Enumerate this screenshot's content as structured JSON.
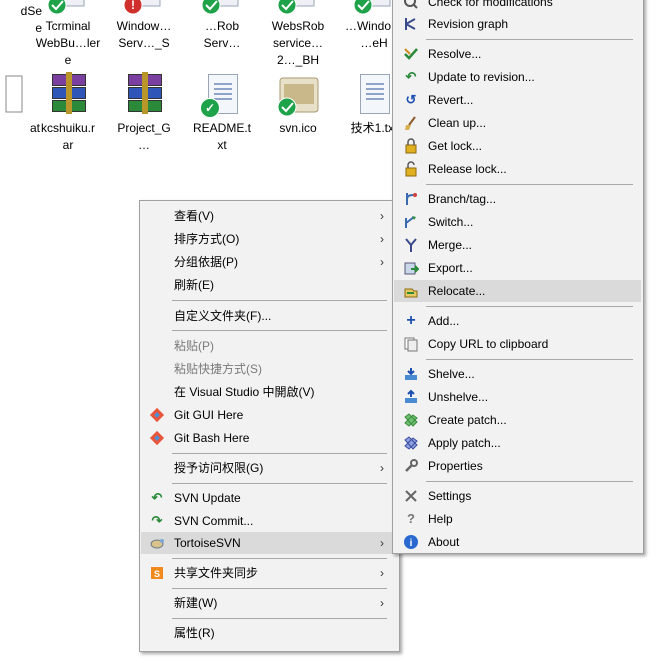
{
  "desktop": {
    "files": [
      {
        "label": "ata\ndSe\ne",
        "kind": "partial"
      },
      {
        "label": "Tcrminal\nWebBu…ler\ne",
        "kind": "vs"
      },
      {
        "label": "Window…\nServ…_S",
        "kind": "vs-error"
      },
      {
        "label": "…Rob\nServ…",
        "kind": "vs"
      },
      {
        "label": "WebsRob\nservice…\n2…_BH",
        "kind": "vs"
      },
      {
        "label": "…Windo…\n…eH",
        "kind": "vs"
      },
      {
        "label": "at",
        "kind": "partial"
      },
      {
        "label": "kcshuiku.r\nar",
        "kind": "rar"
      },
      {
        "label": "Project_G\n…",
        "kind": "rar"
      },
      {
        "label": "README.t\nxt",
        "kind": "doc-svn"
      },
      {
        "label": "svn.ico",
        "kind": "svn-ico"
      },
      {
        "label": "技术1.txt",
        "kind": "doc"
      }
    ]
  },
  "context_menu": {
    "items": [
      {
        "label": "查看(V)",
        "submenu": true,
        "icon": ""
      },
      {
        "label": "排序方式(O)",
        "submenu": true,
        "icon": ""
      },
      {
        "label": "分组依据(P)",
        "submenu": true,
        "icon": ""
      },
      {
        "label": "刷新(E)",
        "submenu": false,
        "icon": ""
      },
      {
        "label": "自定义文件夹(F)...",
        "submenu": false,
        "icon": ""
      },
      {
        "label": "粘贴(P)",
        "submenu": false,
        "icon": "",
        "disabled": true
      },
      {
        "label": "粘贴快捷方式(S)",
        "submenu": false,
        "icon": "",
        "disabled": true
      },
      {
        "label": "在 Visual Studio 中開啟(V)",
        "submenu": false,
        "icon": ""
      },
      {
        "label": "Git GUI Here",
        "submenu": false,
        "icon": "git-icon"
      },
      {
        "label": "Git Bash Here",
        "submenu": false,
        "icon": "git-icon"
      },
      {
        "label": "授予访问权限(G)",
        "submenu": true,
        "icon": ""
      },
      {
        "label": "SVN Update",
        "submenu": false,
        "icon": "svn-update-icon"
      },
      {
        "label": "SVN Commit...",
        "submenu": false,
        "icon": "svn-commit-icon"
      },
      {
        "label": "TortoiseSVN",
        "submenu": true,
        "icon": "tortoise-icon",
        "highlighted": true
      },
      {
        "label": "共享文件夹同步",
        "submenu": true,
        "icon": "sync-icon"
      },
      {
        "label": "新建(W)",
        "submenu": true,
        "icon": ""
      },
      {
        "label": "属性(R)",
        "submenu": false,
        "icon": ""
      }
    ]
  },
  "tortoise_submenu": {
    "items": [
      {
        "label": "Check for modifications",
        "icon": "check-mod-icon"
      },
      {
        "label": "Revision graph",
        "icon": "revision-graph-icon"
      },
      {
        "label": "Resolve...",
        "icon": "resolve-icon"
      },
      {
        "label": "Update to revision...",
        "icon": "update-rev-icon"
      },
      {
        "label": "Revert...",
        "icon": "revert-icon"
      },
      {
        "label": "Clean up...",
        "icon": "cleanup-icon"
      },
      {
        "label": "Get lock...",
        "icon": "lock-icon"
      },
      {
        "label": "Release lock...",
        "icon": "unlock-icon"
      },
      {
        "label": "Branch/tag...",
        "icon": "branch-icon"
      },
      {
        "label": "Switch...",
        "icon": "switch-icon"
      },
      {
        "label": "Merge...",
        "icon": "merge-icon"
      },
      {
        "label": "Export...",
        "icon": "export-icon"
      },
      {
        "label": "Relocate...",
        "icon": "relocate-icon",
        "highlighted": true
      },
      {
        "label": "Add...",
        "icon": "add-icon"
      },
      {
        "label": "Copy URL to clipboard",
        "icon": "copy-url-icon"
      },
      {
        "label": "Shelve...",
        "icon": "shelve-icon"
      },
      {
        "label": "Unshelve...",
        "icon": "unshelve-icon"
      },
      {
        "label": "Create patch...",
        "icon": "create-patch-icon"
      },
      {
        "label": "Apply patch...",
        "icon": "apply-patch-icon"
      },
      {
        "label": "Properties",
        "icon": "properties-icon"
      },
      {
        "label": "Settings",
        "icon": "settings-icon"
      },
      {
        "label": "Help",
        "icon": "help-icon"
      },
      {
        "label": "About",
        "icon": "about-icon"
      }
    ]
  },
  "colors": {
    "menu_bg": "#f2f2f2",
    "highlight": "#dadada",
    "separator": "#a8a8a8",
    "disabled_text": "#7a7a7a"
  }
}
